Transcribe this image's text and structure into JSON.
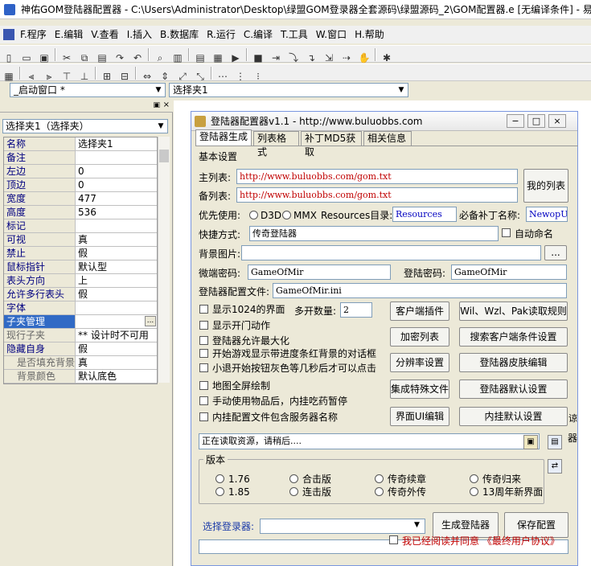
{
  "window": {
    "title": "神佑GOM登陆器配置器 - C:\\Users\\Administrator\\Desktop\\绿盟GOM登录器全套源码\\绿盟源码_2\\GOM配置器.e [无编译条件] - 易"
  },
  "menu": [
    "F.程序",
    "E.编辑",
    "V.查看",
    "I.插入",
    "B.数据库",
    "R.运行",
    "C.编译",
    "T.工具",
    "W.窗口",
    "H.帮助"
  ],
  "toolbar": {
    "row1": [
      "new-icon",
      "open-icon",
      "save-icon",
      "cut-icon",
      "copy-icon",
      "paste-icon",
      "redo-icon",
      "undo-icon",
      "find-icon",
      "layout1-icon",
      "layout2-icon",
      "layout3-icon",
      "run-icon",
      "stop-icon",
      "step1-icon",
      "step2-icon",
      "step3-icon",
      "step4-icon",
      "step5-icon",
      "hand-icon",
      "debug-icon"
    ],
    "row2": [
      "grid-icon",
      "align1-icon",
      "align2-icon",
      "align3-icon",
      "align4-icon",
      "center1-icon",
      "center2-icon",
      "size1-icon",
      "size2-icon",
      "size3-icon",
      "size4-icon",
      "space1-icon",
      "space2-icon",
      "space3-icon"
    ]
  },
  "combos": {
    "window_select": "_启动窗口 *",
    "object_select": "选择夹1"
  },
  "left_panel": {
    "object": "选择夹1（选择夹）",
    "props": [
      {
        "n": "名称",
        "v": "选择夹1",
        "type": "normal"
      },
      {
        "n": "备注",
        "v": "",
        "type": "normal"
      },
      {
        "n": "左边",
        "v": "0",
        "type": "normal"
      },
      {
        "n": "顶边",
        "v": "0",
        "type": "normal"
      },
      {
        "n": "宽度",
        "v": "477",
        "type": "normal"
      },
      {
        "n": "高度",
        "v": "536",
        "type": "normal"
      },
      {
        "n": "标记",
        "v": "",
        "type": "normal"
      },
      {
        "n": "可视",
        "v": "真",
        "type": "normal"
      },
      {
        "n": "禁止",
        "v": "假",
        "type": "normal"
      },
      {
        "n": "鼠标指针",
        "v": "默认型",
        "type": "normal"
      },
      {
        "n": "表头方向",
        "v": "上",
        "type": "normal"
      },
      {
        "n": "允许多行表头",
        "v": "假",
        "type": "normal"
      },
      {
        "n": "字体",
        "v": "",
        "type": "normal"
      },
      {
        "n": "子夹管理",
        "v": "",
        "type": "sel"
      },
      {
        "n": "现行子夹",
        "v": "** 设计时不可用",
        "type": "grey"
      },
      {
        "n": "隐藏自身",
        "v": "假",
        "type": "normal"
      },
      {
        "n": "是否填充背景",
        "v": "真",
        "type": "sub"
      },
      {
        "n": "背景颜色",
        "v": "默认底色",
        "type": "sub"
      }
    ]
  },
  "form": {
    "title": "登陆器配置器v1.1 - http://www.buluobbs.com",
    "tabs": [
      "登陆器生成",
      "列表格式",
      "补丁MD5获取",
      "相关信息"
    ],
    "basic_title": "基本设置",
    "main_list_label": "主列表:",
    "main_list": "http://www.buluobbs.com/gom.txt",
    "backup_list_label": "备列表:",
    "backup_list": "http://www.buluobbs.com/gom.txt",
    "my_list_btn": "我的列表",
    "priority_label": "优先使用:",
    "d3d": "D3D",
    "mmx": "MMX",
    "resources_label": "Resources目录:",
    "resources": "Resources",
    "patch_label": "必备补丁名称:",
    "patch": "NewopUI",
    "shortcut_label": "快捷方式:",
    "shortcut": "传奇登陆器",
    "autoname": "自动命名",
    "bg_label": "背景图片:",
    "browse": "...",
    "micro_pwd_label": "微端密码:",
    "micro_pwd": "GameOfMir",
    "login_pwd_label": "登陆密码:",
    "login_pwd": "GameOfMir",
    "cfg_label": "登陆器配置文件:",
    "cfg": "GameOfMir.ini",
    "options": [
      "显示1024的界面",
      "显示开门动作",
      "登陆器允许最大化",
      "开始游戏显示带进度条红背景的对话框",
      "小退开始按钮灰色等几秒后才可以点击",
      "地图全屏绘制",
      "手动使用物品后，内挂吃药暂停",
      "内挂配置文件包含服务器名称"
    ],
    "multi_label": "多开数量:",
    "multi": "2",
    "buttons": [
      "客户端插件",
      "Wil、Wzl、Pak读取规则",
      "加密列表",
      "搜索客户端条件设置",
      "分辨率设置",
      "登陆器皮肤编辑",
      "集成特殊文件",
      "登陆器默认设置",
      "界面UI编辑",
      "内挂默认设置"
    ],
    "status": "正在读取资源，请稍后....",
    "version_title": "版本",
    "versions": [
      "1.76",
      "合击版",
      "传奇续章",
      "传奇归来",
      "1.85",
      "连击版",
      "传奇外传",
      "13周年新界面"
    ],
    "select_login_label": "选择登录器:",
    "generate_btn": "生成登陆器",
    "save_btn": "保存配置",
    "agree": "我已经阅读并同意 《最终用户协议》"
  }
}
